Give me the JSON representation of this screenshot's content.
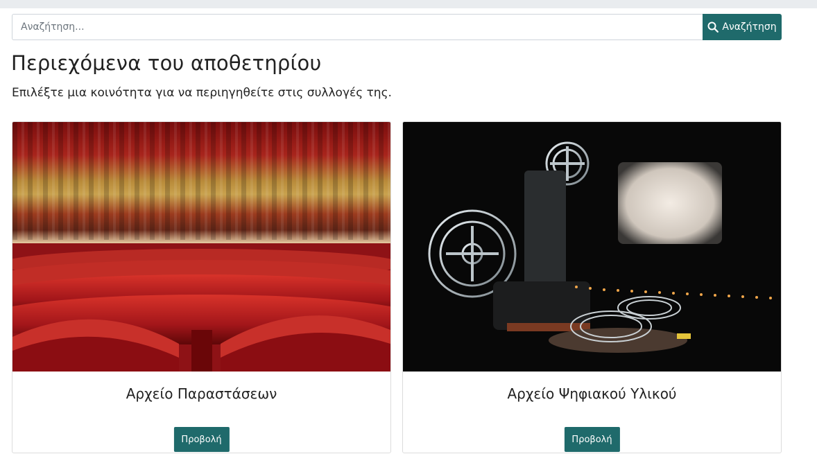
{
  "search": {
    "placeholder": "Αναζήτηση...",
    "button_label": "Αναζήτηση"
  },
  "main": {
    "title": "Περιεχόμενα του αποθετηρίου",
    "lead": "Επιλέξτε μια κοινότητα για να περιηγηθείτε στις συλλογές της."
  },
  "communities": [
    {
      "title": "Αρχείο Παραστάσεων",
      "button_label": "Προβολή"
    },
    {
      "title": "Αρχείο Ψηφιακού Υλικού",
      "button_label": "Προβολή"
    }
  ],
  "colors": {
    "accent": "#1f6a6b",
    "topbar": "#e9ecef"
  }
}
